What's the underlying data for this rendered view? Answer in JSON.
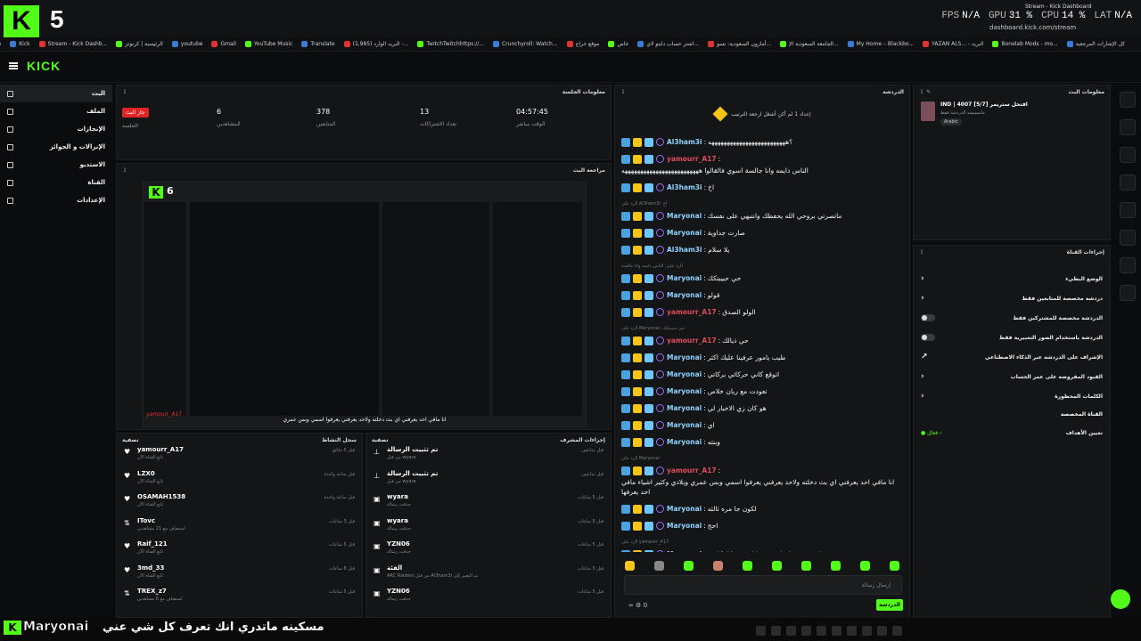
{
  "overlay": {
    "viewer_count": "5",
    "perf": [
      {
        "label": "FPS",
        "value": "N/A"
      },
      {
        "label": "GPU",
        "value": "31 %"
      },
      {
        "label": "CPU",
        "value": "14 %"
      },
      {
        "label": "LAT",
        "value": "N/A"
      }
    ],
    "bottom_name": "Maryonai",
    "bottom_message": "مسكينه ماتدري انك تعرف كل شي عني"
  },
  "browser": {
    "tab_title": "Stream - Kick Dashboard",
    "url": "dashboard.kick.com/stream",
    "bookmarks": [
      "كل الإشارات المرجعية",
      "Bonelab Mods - mo...",
      "YAZAN ALS... - البريد",
      "My Home – Blackbo...",
      "الجامعة السعودية الإ...",
      "أمازون السعودية: تسو...",
      "اشتر حساب دايتو لاي...",
      "خاص",
      "موقع حراج",
      "Crunchyroll: Watch...",
      "TwitchTwitchhttps://...",
      "(1,985) البريد الوارد -...",
      "Translate",
      "YouTube Music",
      "Gmail",
      "youtube",
      "الرئيسية | كرتونز",
      "Stream - Kick Dashb...",
      "Kick",
      "Google"
    ]
  },
  "sidebar": {
    "items": [
      {
        "label": "البث"
      },
      {
        "label": "الملف"
      },
      {
        "label": "الإنجازات"
      },
      {
        "label": "الإنزالات و الجوائز"
      },
      {
        "label": "الاستديو"
      },
      {
        "label": "القناة"
      },
      {
        "label": "الإعدادات"
      }
    ]
  },
  "session": {
    "title": "معلومات الجلسة",
    "live_badge": "جار البث",
    "live_label": "الجلسة",
    "stats": [
      {
        "value": "6",
        "label": "المشاهدين"
      },
      {
        "value": "378",
        "label": "المتابعين"
      },
      {
        "value": "13",
        "label": "تعداد الاشتراكات"
      },
      {
        "value": "04:57:45",
        "label": "الوقت مباشر"
      }
    ]
  },
  "preview": {
    "title": "مراجعة البث",
    "num": "6",
    "caption": "انا مافي احد يعرفني اي بث دخلته ولاحد يعرفني يعرفوا اسمي وبس عمري",
    "red_name": "yamourr_A17"
  },
  "events": {
    "title": "سجل النشاط",
    "filter": "تصفية",
    "items": [
      {
        "icon": "heart-icon",
        "glyph": "♥",
        "name": "yamourr_A17",
        "sub": "تابع القناة الآن",
        "time": "قبل 5 دقائق"
      },
      {
        "icon": "heart-icon",
        "glyph": "♥",
        "name": "LZX0",
        "sub": "تابع القناة الآن",
        "time": "قبل ساعة واحدة"
      },
      {
        "icon": "heart-icon",
        "glyph": "♥",
        "name": "OSAMAH1538",
        "sub": "تابع القناة الآن",
        "time": "قبل ساعة واحدة"
      },
      {
        "icon": "host-icon",
        "glyph": "⇅",
        "name": "ITovc",
        "sub": "استضاف مع 21 مشاهدين",
        "time": "قبل 3 ساعات"
      },
      {
        "icon": "heart-icon",
        "glyph": "♥",
        "name": "Raif_121",
        "sub": "تابع القناة الآن",
        "time": "قبل 5 ساعات"
      },
      {
        "icon": "heart-icon",
        "glyph": "♥",
        "name": "3md_33",
        "sub": "تابع القناة الآن",
        "time": "قبل 6 ساعات"
      },
      {
        "icon": "host-icon",
        "glyph": "⇅",
        "name": "TREX_z7",
        "sub": "استضاف مع 6 مشاهدين",
        "time": "قبل 5 ساعات"
      }
    ]
  },
  "modactions": {
    "title": "إجراءات المشرف",
    "filter": "تصفية",
    "items": [
      {
        "icon": "pin-icon",
        "glyph": "⊥",
        "name": "تم تثبيت الرسالة",
        "sub": "من قبل wyara",
        "time": "قبل ساعتين"
      },
      {
        "icon": "pin-icon",
        "glyph": "⊥",
        "name": "تم تثبيت الرسالة",
        "sub": "من قبل wyara",
        "time": "قبل ساعتين"
      },
      {
        "icon": "trash-icon",
        "glyph": "▣",
        "name": "wyara",
        "sub": "حذفت رسالة",
        "time": "قبل 5 ساعات"
      },
      {
        "icon": "trash-icon",
        "glyph": "▣",
        "name": "wyara",
        "sub": "حذفت رسالة",
        "time": "قبل 5 ساعات"
      },
      {
        "icon": "trash-icon",
        "glyph": "▣",
        "name": "YZN06",
        "sub": "حذفت رسالة",
        "time": "قبل 5 ساعات"
      },
      {
        "icon": "trash-icon",
        "glyph": "▣",
        "name": "الفئة",
        "sub": "ARC Raiders من قبل Al3ham3i تم التغيير إلى",
        "time": "قبل 5 ساعات"
      },
      {
        "icon": "trash-icon",
        "glyph": "▣",
        "name": "YZN06",
        "sub": "حذفت رسالة",
        "time": "قبل 5 ساعات"
      }
    ]
  },
  "chat": {
    "title": "الدردشة",
    "pinned": "إعداد 1 لم أكن أشغل ارجعة الترتيب",
    "messages": [
      {
        "user": "Al3ham3i",
        "red": false,
        "text": "؟هههههههههههههههههههههههههه",
        "reply": ""
      },
      {
        "user": "yamourr_A17",
        "red": true,
        "text": "الناس دايمه وانا جالسة اسوي فالقالوا هههههههههههههههههههههههههه",
        "reply": ""
      },
      {
        "user": "Al3ham3i",
        "red": false,
        "text": "اخ",
        "reply": ""
      },
      {
        "user": "Maryonai",
        "red": false,
        "text": "ماتصرتي بروحي الله يحفظك وانتبهي على نفسك",
        "reply": "الرد على Al3ham3i: اخ"
      },
      {
        "user": "Maryonai",
        "red": false,
        "text": "صارت جداوية",
        "reply": ""
      },
      {
        "user": "Al3ham3i",
        "red": false,
        "text": "يلا سلام",
        "reply": ""
      },
      {
        "user": "Maryonai",
        "red": false,
        "text": "حي حبيبتكك",
        "reply": "الرد على: الناس دايمه وانا جالسة"
      },
      {
        "user": "Maryonai",
        "red": false,
        "text": "قولو",
        "reply": ""
      },
      {
        "user": "yamourr_A17",
        "red": true,
        "text": "الولو الصدق",
        "reply": ""
      },
      {
        "user": "yamourr_A17",
        "red": true,
        "text": "حي ذيالك",
        "reply": "الرد على Maryonai: حي حبيبتكك"
      },
      {
        "user": "Maryonai",
        "red": false,
        "text": "طيب يامور عرفينا عليك اكثر",
        "reply": ""
      },
      {
        "user": "Maryonai",
        "red": false,
        "text": "اتوقع كاني حركاتي بركاتي",
        "reply": ""
      },
      {
        "user": "Maryonai",
        "red": false,
        "text": "تعودت مع ريان خلاص",
        "reply": ""
      },
      {
        "user": "Maryonai",
        "red": false,
        "text": "هو كان زي الاخبار لي",
        "reply": ""
      },
      {
        "user": "Maryonai",
        "red": false,
        "text": "اي",
        "reply": ""
      },
      {
        "user": "Maryonai",
        "red": false,
        "text": "وبنته",
        "reply": ""
      },
      {
        "user": "yamourr_A17",
        "red": true,
        "text": "انا مافي احد يعرفني اي بث دخلته ولاحد يعرفني يعرفوا اسمي وبس عمري وبلادي وكثير اشياء مافي احد يعرفها",
        "reply": "الرد على Maryonai"
      },
      {
        "user": "Maryonai",
        "red": false,
        "text": "لكون جا مره ثالثه",
        "reply": ""
      },
      {
        "user": "Maryonai",
        "red": false,
        "text": "احج",
        "reply": ""
      },
      {
        "user": "Maryonai",
        "red": false,
        "text": "ابدد خذي راحتك متى ما ارتحتي انا تكلمي",
        "reply": "الرد على yamourr_A17"
      },
      {
        "user": "Maryonai",
        "red": false,
        "text": "مسكينه ماتدري انك تعرف كل شي عني",
        "reply": ""
      }
    ],
    "input_placeholder": "إرسال رسالة",
    "send_label": "الدردشة",
    "viewer_count": "0"
  },
  "chaninfo": {
    "title": "معلومات البث",
    "stream_title": "IND | 4007 [5/7] اقتحل ستريمر",
    "subtitle": "ماسميسة الدردشة فقط",
    "tag": "Arabic"
  },
  "chanact": {
    "title": "إجراءات القناة",
    "rows": [
      {
        "label": "الوضع البطيء",
        "kind": "chevron"
      },
      {
        "label": "دردشة مخصصة للمتابعين فقط",
        "kind": "chevron"
      },
      {
        "label": "الدردشة مخصصة للمشتركين فقط",
        "kind": "toggle"
      },
      {
        "label": "الدردشة باستخدام الصور التعبيرية فقط",
        "kind": "toggle"
      },
      {
        "label": "الإشراف على الدردشة عبر الذكاء الاصطناعي",
        "kind": "link"
      },
      {
        "label": "القيود المفروضة على عمر الحساب",
        "kind": "chevron"
      },
      {
        "label": "الكلمات المحظورة",
        "kind": "chevron"
      }
    ],
    "section": "القناة المخصصة",
    "goals_label": "تعيين الأهداف",
    "goals_status": "فعال"
  }
}
